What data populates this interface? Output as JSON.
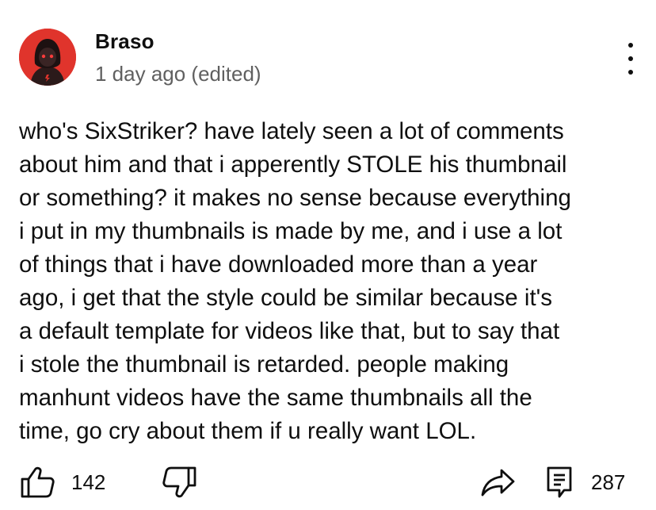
{
  "comment": {
    "author": "Braso",
    "timestamp": "1 day ago (edited)",
    "text": "who's SixStriker? have lately seen a lot of comments\nabout him and that i apperently STOLE his thumbnail\nor something? it makes no sense because everything\ni put in my thumbnails is made by me, and i use a lot\nof things that i have downloaded more than a year\nago, i get that the style could be similar because it's\na default template for videos like that, but to say that\ni stole the thumbnail is retarded. people making\nmanhunt videos have the same thumbnails all the\ntime, go cry about them if u really want LOL.",
    "like_count": "142",
    "reply_count": "287"
  },
  "icons": {
    "avatar": "hooded-figure-avatar",
    "menu": "more-vertical-icon",
    "like": "thumbs-up-icon",
    "dislike": "thumbs-down-icon",
    "share": "share-icon",
    "reply": "reply-icon"
  },
  "colors": {
    "avatar_background": "#e0342c",
    "text_primary": "#0f0f0f",
    "text_secondary": "#606060"
  }
}
